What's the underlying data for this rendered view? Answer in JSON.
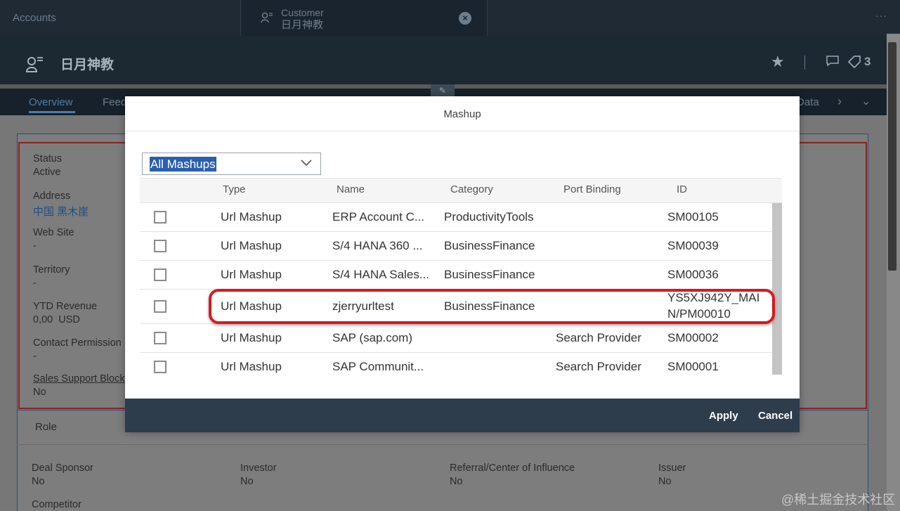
{
  "topbar": {
    "tab_accounts": "Accounts",
    "tab_customer_line1": "Customer",
    "tab_customer_line2": "日月神教",
    "more": "···"
  },
  "object_header": {
    "title": "日月神教",
    "count": "3"
  },
  "navbar": {
    "overview": "Overview",
    "feed": "Feed",
    "data": "Data"
  },
  "details": {
    "status_label": "Status",
    "status_value": "Active",
    "address_label": "Address",
    "address_value": "中国 黑木崖",
    "website_label": "Web Site",
    "website_value": "-",
    "territory_label": "Territory",
    "territory_value": "-",
    "ytd_label": "YTD Revenue",
    "ytd_value": "0,00  USD",
    "contact_label": "Contact Permission",
    "contact_value": "-",
    "sales_label": "Sales Support Block",
    "sales_value": "No"
  },
  "role": {
    "title": "Role",
    "items": [
      {
        "label": "Deal Sponsor",
        "value": "No"
      },
      {
        "label": "Investor",
        "value": "No"
      },
      {
        "label": "Referral/Center of Influence",
        "value": "No"
      },
      {
        "label": "Issuer",
        "value": "No"
      }
    ],
    "competitor_label": "Competitor"
  },
  "watermark": "@稀土掘金技术社区",
  "dialog": {
    "title": "Mashup",
    "filter_value": "All Mashups",
    "columns": [
      "Type",
      "Name",
      "Category",
      "Port Binding",
      "ID"
    ],
    "rows": [
      {
        "type": "Url Mashup",
        "name": "ERP Account C...",
        "category": "ProductivityTools",
        "port": "",
        "id": "SM00105"
      },
      {
        "type": "Url Mashup",
        "name": "S/4 HANA 360 ...",
        "category": "BusinessFinance",
        "port": "",
        "id": "SM00039"
      },
      {
        "type": "Url Mashup",
        "name": "S/4 HANA Sales...",
        "category": "BusinessFinance",
        "port": "",
        "id": "SM00036"
      },
      {
        "type": "Url Mashup",
        "name": "zjerryurltest",
        "category": "BusinessFinance",
        "port": "",
        "id_line1": "YS5XJ942Y_MAI",
        "id_line2": "N/PM00010"
      },
      {
        "type": "Url Mashup",
        "name": "SAP (sap.com)",
        "category": "",
        "port": "Search Provider",
        "id": "SM00002"
      },
      {
        "type": "Url Mashup",
        "name": "SAP Communit...",
        "category": "",
        "port": "Search Provider",
        "id": "SM00001"
      }
    ],
    "apply_label": "Apply",
    "cancel_label": "Cancel"
  }
}
